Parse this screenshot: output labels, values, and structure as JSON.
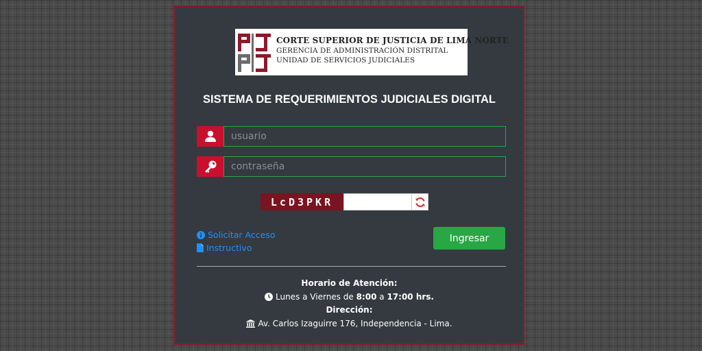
{
  "logo": {
    "line1": "CORTE SUPERIOR DE JUSTICIA DE LIMA NORTE",
    "line2": "GERENCIA DE ADMINISTRACIÓN DISTRITAL",
    "line3": "UNIDAD DE SERVICIOS JUDICIALES"
  },
  "title": "SISTEMA DE REQUERIMIENTOS JUDICIALES DIGITAL",
  "form": {
    "username_placeholder": "usuario",
    "password_placeholder": "contraseña",
    "captcha_text": "LcD3PKR",
    "submit_label": "Ingresar"
  },
  "links": {
    "request_access": "Solicitar Acceso",
    "instructions": "Instructivo"
  },
  "footer": {
    "hours_heading": "Horario de Atención:",
    "days": "Lunes a Viernes de",
    "start": "8:00",
    "connector": "a",
    "end": "17:00 hrs.",
    "address_heading": "Dirección:",
    "address": "Av. Carlos Izaguirre 176, Independencia - Lima."
  },
  "icons": {
    "user": "user-icon",
    "key": "key-icon",
    "refresh": "refresh-icon",
    "info": "info-circle-icon",
    "file": "file-icon",
    "clock": "clock-icon",
    "institution": "institution-icon"
  },
  "colors": {
    "accent_red": "#c8102e",
    "button_green": "#28a745",
    "link_blue": "#1e90ff",
    "panel_bg": "#343a40"
  }
}
